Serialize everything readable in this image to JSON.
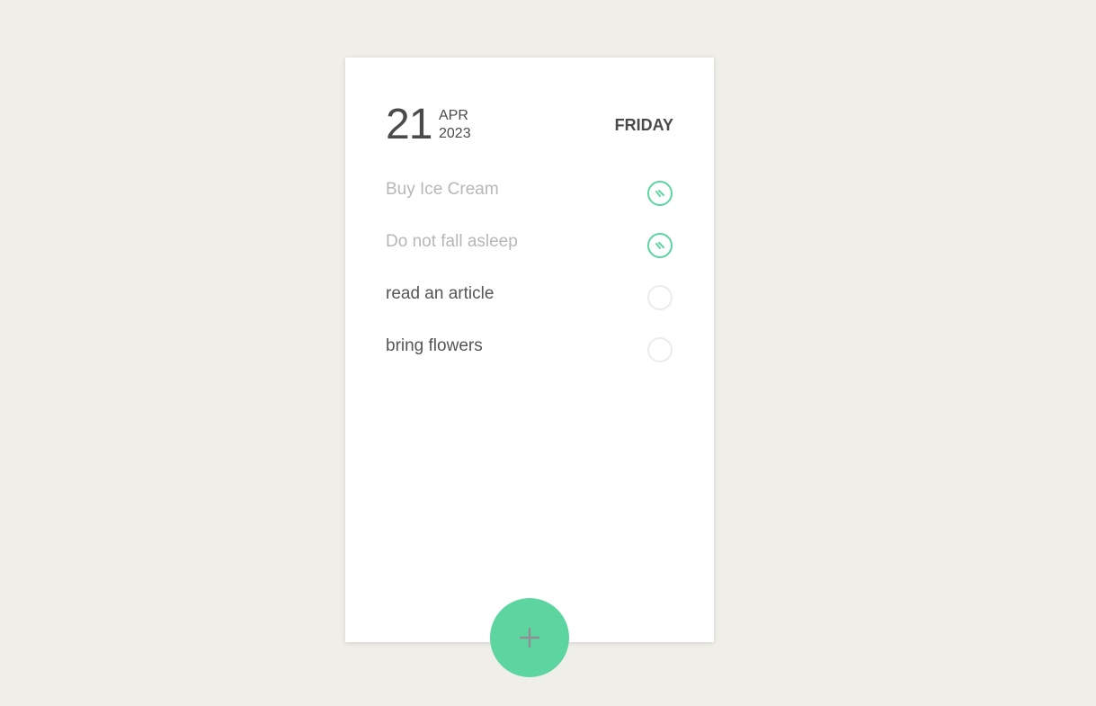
{
  "date": {
    "day": "21",
    "month": "APR",
    "year": "2023",
    "weekday": "FRIDAY"
  },
  "tasks": [
    {
      "label": "Buy Ice Cream",
      "done": true
    },
    {
      "label": "Do not fall asleep",
      "done": true
    },
    {
      "label": "read an article",
      "done": false
    },
    {
      "label": "bring flowers",
      "done": false
    }
  ],
  "add_button": {
    "icon": "plus-icon"
  },
  "colors": {
    "background": "#efeee9",
    "card": "#ffffff",
    "accent": "#5dd5a0",
    "text": "#4a4a4a",
    "done_text": "#b7b7b7",
    "unchecked_ring": "#ececef",
    "plus_icon": "#8f8f96"
  }
}
